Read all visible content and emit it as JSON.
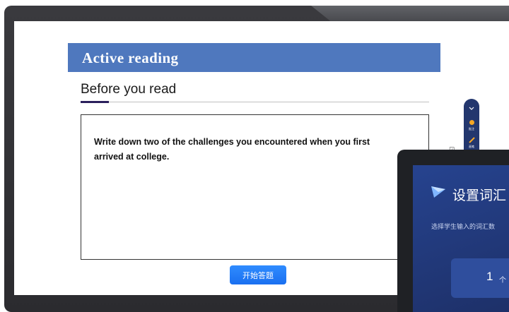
{
  "lesson": {
    "banner_title": "Active  reading",
    "section_heading": "Before you read",
    "prompt": "Write down two of the challenges you encountered when you first arrived at college.",
    "start_button_label": "开始答题"
  },
  "toolbar": {
    "items": [
      {
        "icon": "chevron-icon",
        "label": ""
      },
      {
        "icon": "hand-icon",
        "label": "批注"
      },
      {
        "icon": "pen-icon",
        "label": "画笔"
      }
    ]
  },
  "tablet_dialog": {
    "title": "设置词汇",
    "description": "选择学生输入的词汇数",
    "count_value": "1",
    "count_unit": "个"
  },
  "colors": {
    "banner": "#4f78be",
    "accent": "#2a1f5c",
    "button": "#1a6ff0",
    "tablet_bg": "#26438f"
  }
}
